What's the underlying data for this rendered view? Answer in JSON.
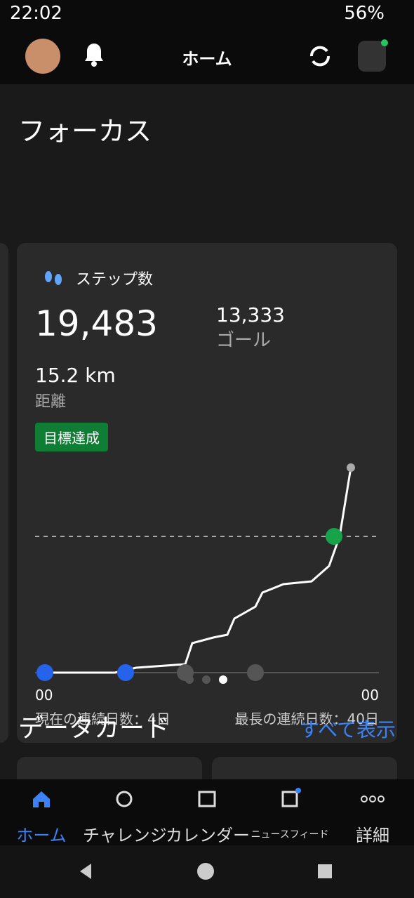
{
  "status": {
    "time": "22:02",
    "battery": "56%"
  },
  "appbar": {
    "title": "ホーム"
  },
  "focus": {
    "title": "フォーカス"
  },
  "card": {
    "label": "ステップ数",
    "steps": "19,483",
    "goal_value": "13,333",
    "goal_label": "ゴール",
    "distance_value": "15.2 km",
    "distance_label": "距離",
    "badge": "目標達成",
    "chart_left": "00",
    "chart_right": "00",
    "streak_current": "現在の連続日数：4日",
    "streak_longest": "最長の連続日数：40日"
  },
  "data_cards": {
    "title": "データカード",
    "view_all": "すべて表示"
  },
  "tabs": [
    {
      "label": "ホーム"
    },
    {
      "label": "チャレンジ"
    },
    {
      "label": "カレンダー"
    },
    {
      "label": "ニュースフィード"
    },
    {
      "label": "詳細"
    }
  ]
}
